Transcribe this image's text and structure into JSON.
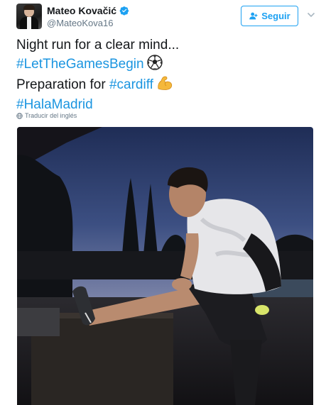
{
  "user": {
    "display_name": "Mateo Kovačić",
    "handle": "@MateoKova16",
    "verified_icon": "verified-badge-icon",
    "avatar_icon": "profile-avatar"
  },
  "actions": {
    "follow_label": "Seguir",
    "follow_icon": "follow-person-icon",
    "menu_icon": "chevron-down-icon"
  },
  "tweet": {
    "line1": "Night run for a clear mind...",
    "hashtag_games": "#LetTheGamesBegin",
    "line3_prefix": "Preparation for ",
    "hashtag_cardiff": "#cardiff",
    "hashtag_madrid": "#HalaMadrid",
    "emoji_soccer": "soccer-ball-emoji",
    "emoji_muscle": "flexed-biceps-emoji"
  },
  "translate": {
    "label": "Traducir del inglés",
    "icon": "globe-icon"
  },
  "media": {
    "type": "photo",
    "subject": "man stretching leg at dusk"
  },
  "colors": {
    "accent": "#1da1f2",
    "hashtag": "#1b95e0",
    "muted": "#657786",
    "text": "#14171a"
  }
}
